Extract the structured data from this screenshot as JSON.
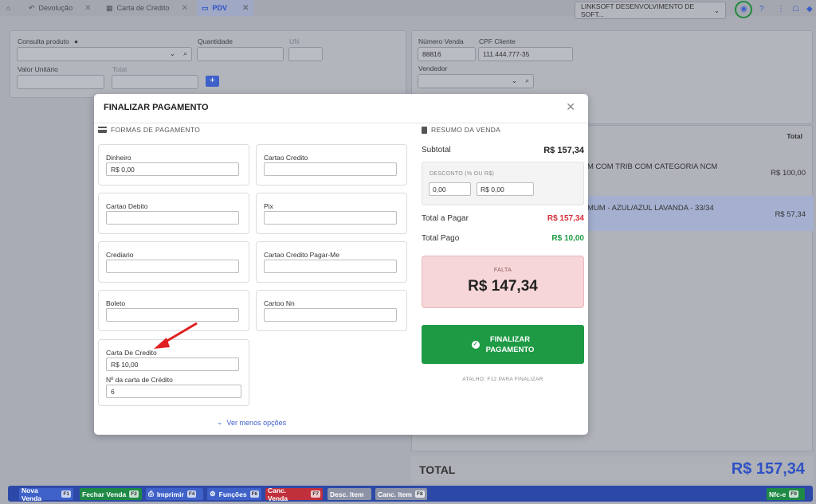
{
  "tabs": [
    {
      "label": "Devolução",
      "icon": "undo-icon"
    },
    {
      "label": "Carta de Credito",
      "icon": "calendar-icon"
    },
    {
      "label": "PDV",
      "icon": "monitor-icon"
    }
  ],
  "company": {
    "name": "LINKSOFT DESENVOLVIMENTO DE SOFT..."
  },
  "product_panel": {
    "consulta_label": "Consulta produto",
    "quantidade_label": "Quantidade",
    "un_label": "UN",
    "valor_unitario_label": "Valor Unitário",
    "total_label": "Total"
  },
  "sale_panel": {
    "numero_label": "Número Venda",
    "numero_value": "88816",
    "cpf_label": "CPF Cliente",
    "cpf_value": "111.444.777-35",
    "vendedor_label": "Vendedor"
  },
  "items": {
    "total_header": "Total",
    "rows": [
      {
        "desc": "M COM TRIB COM CATEGORIA NCM",
        "price": "R$ 100,00"
      },
      {
        "desc": "MUM - AZUL/AZUL LAVANDA - 33/34",
        "price": "R$ 57,34"
      }
    ]
  },
  "grand_total": {
    "label": "TOTAL",
    "value": "R$ 157,34"
  },
  "function_keys": [
    {
      "label": "Nova Venda",
      "key": "F1",
      "color": "#3f62c9"
    },
    {
      "label": "Fechar Venda",
      "key": "F2",
      "color": "#1e8a45"
    },
    {
      "label": "Imprimir",
      "key": "F4",
      "color": "#3f62c9"
    },
    {
      "label": "Funções",
      "key": "F6",
      "color": "#3f62c9"
    },
    {
      "label": "Canc. Venda",
      "key": "F7",
      "color": "#c0303c"
    },
    {
      "label": "Desc. Item",
      "key": "",
      "color": "#8d93a6"
    },
    {
      "label": "Canc. Item",
      "key": "F8",
      "color": "#8d93a6"
    },
    {
      "label": "Nfc-e",
      "key": "F9",
      "color": "#1e8a45"
    }
  ],
  "modal": {
    "title": "FINALIZAR PAGAMENTO",
    "formas_title": "FORMAS DE PAGAMENTO",
    "resumo_title": "RESUMO DA VENDA",
    "methods": [
      {
        "name": "Dinheiro",
        "value": "R$ 0,00"
      },
      {
        "name": "Cartao Credito",
        "value": ""
      },
      {
        "name": "Cartao Debito",
        "value": ""
      },
      {
        "name": "Pix",
        "value": ""
      },
      {
        "name": "Crediario",
        "value": ""
      },
      {
        "name": "Cartao Credito Pagar-Me",
        "value": ""
      },
      {
        "name": "Boleto",
        "value": ""
      },
      {
        "name": "Cartoo Nn",
        "value": ""
      }
    ],
    "carta": {
      "name": "Carta De Credito",
      "value": "R$ 10,00",
      "number_label": "Nº da carta de Crédito",
      "number_value": "6"
    },
    "less_options": "Ver menos opções",
    "subtotal_label": "Subtotal",
    "subtotal_value": "R$ 157,34",
    "desconto_label": "DESCONTO (% OU R$)",
    "desconto_pct": "0,00",
    "desconto_val": "R$ 0,00",
    "total_pagar_label": "Total a Pagar",
    "total_pagar_value": "R$ 157,34",
    "total_pago_label": "Total Pago",
    "total_pago_value": "R$ 10,00",
    "falta_label": "FALTA",
    "falta_value": "R$ 147,34",
    "finalizar_label_1": "FINALIZAR",
    "finalizar_label_2": "PAGAMENTO",
    "shortcut_hint": "ATALHO: F12 PARA FINALIZAR"
  },
  "colors": {
    "accent": "#3a5ec9",
    "success": "#1e9a45",
    "danger": "#d32f3a",
    "falta_bg": "#f6d6d8"
  }
}
